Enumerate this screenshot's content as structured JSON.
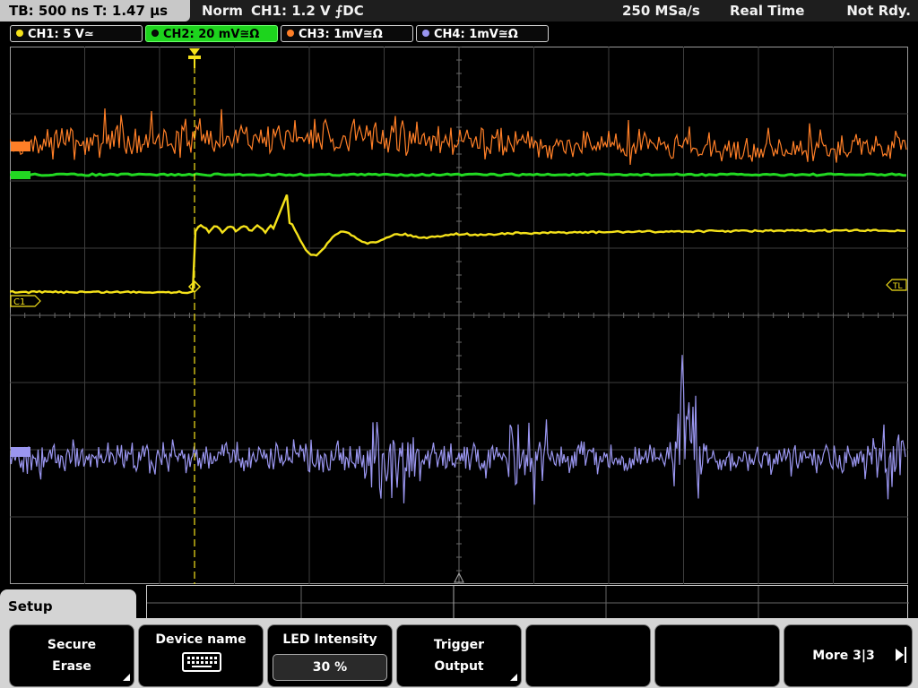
{
  "top_bar": {
    "timebase": "TB: 500 ns   T: 1.47 µs",
    "mode": "Norm",
    "trigger": "CH1: 1.2 V ⨍DC",
    "sample_rate": "250 MSa/s",
    "acq_mode": "Real Time",
    "status": "Not Rdy."
  },
  "channels": [
    {
      "id": "ch1",
      "label": "CH1: 5 V≃",
      "color": "#f5e21a",
      "active": false
    },
    {
      "id": "ch2",
      "label": "CH2: 20 mV≅Ω",
      "color": "#22d822",
      "active": true
    },
    {
      "id": "ch3",
      "label": "CH3: 1mV≅Ω",
      "color": "#ff7f27",
      "active": false
    },
    {
      "id": "ch4",
      "label": "CH4: 1mV≅Ω",
      "color": "#9a96f0",
      "active": false
    }
  ],
  "markers": {
    "ch1": "C1",
    "trigger_level": "TL"
  },
  "menu": {
    "title": "Setup",
    "softkeys": [
      {
        "id": "secure-erase",
        "line1": "Secure",
        "line2": "Erase"
      },
      {
        "id": "device-name",
        "line1": "Device name",
        "line2": ""
      },
      {
        "id": "led-intensity",
        "line1": "LED Intensity",
        "value": "30 %"
      },
      {
        "id": "trigger-output",
        "line1": "Trigger",
        "line2": "Output"
      },
      {
        "id": "empty-1",
        "line1": "",
        "line2": ""
      },
      {
        "id": "empty-2",
        "line1": "",
        "line2": ""
      },
      {
        "id": "more",
        "line1": "More 3|3",
        "line2": ""
      }
    ]
  },
  "colors": {
    "grid": "#5a5a5a",
    "trigger_cursor": "#f5e21a",
    "ch1": "#f5e21a",
    "ch2": "#22d822",
    "ch3": "#ff7f27",
    "ch4": "#9a96f0"
  }
}
